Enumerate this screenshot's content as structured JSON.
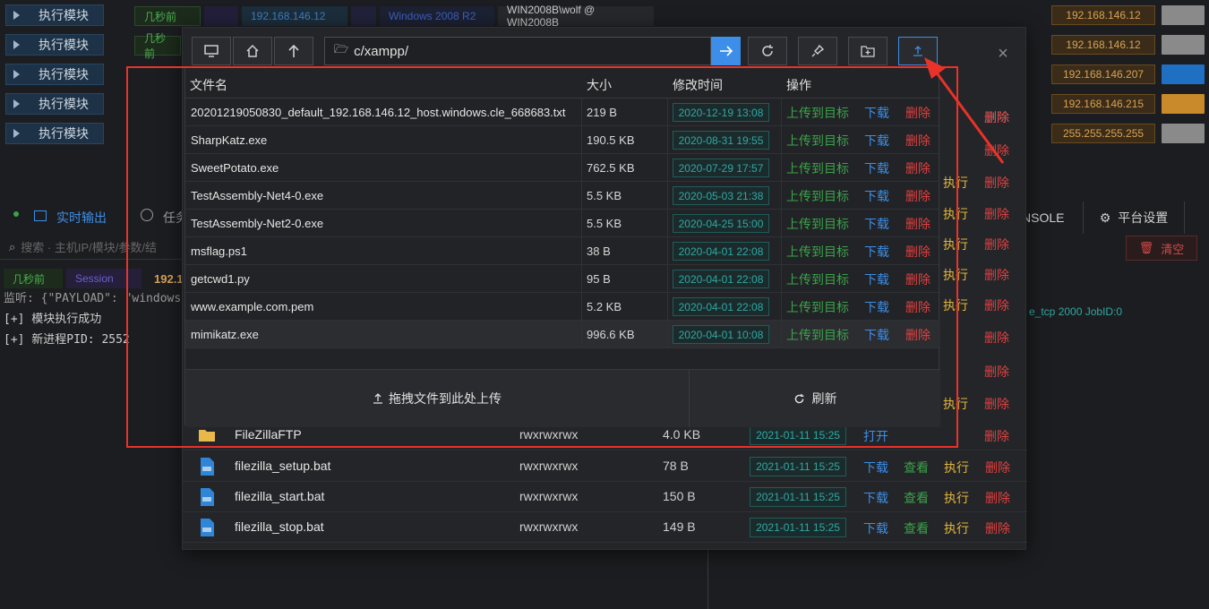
{
  "background": {
    "exec_buttons": [
      "执行模块",
      "执行模块",
      "执行模块",
      "执行模块",
      "执行模块"
    ],
    "session_row": {
      "time": "几秒前",
      "ip": "192.168.146.12",
      "os": "Windows 2008 R2",
      "user": "WIN2008B\\wolf @ WIN2008B"
    },
    "session_row2_time": "几秒前",
    "ip_chips": [
      "192.168.146.12",
      "192.168.146.12",
      "192.168.146.207",
      "192.168.146.215",
      "255.255.255.255"
    ],
    "tabs": {
      "realtime": "实时输出",
      "task": "任务"
    },
    "search_placeholder": "搜索 · 主机IP/模块/参数/结",
    "log_row": {
      "time": "几秒前",
      "session": "Session",
      "ip": "192.1"
    },
    "log_lines": [
      "监听: {\"PAYLOAD\": \"windows/x6",
      "[+] 模块执行成功",
      "[+] 新进程PID: 2552"
    ],
    "right_tabs": {
      "console": "NSOLE",
      "settings": "平台设置"
    },
    "clear_label": "清空",
    "job_text": "e_tcp 2000 JobID:0"
  },
  "modal": {
    "path": "c/xampp/",
    "file_list": [
      {
        "name": "FileZillaFTP",
        "perm": "rwxrwxrwx",
        "size": "4.0 KB",
        "date": "2021-01-11 15:25",
        "ops": [
          "打开"
        ],
        "type": "folder"
      },
      {
        "name": "filezilla_setup.bat",
        "perm": "rwxrwxrwx",
        "size": "78 B",
        "date": "2021-01-11 15:25",
        "ops": [
          "下载",
          "查看",
          "执行",
          "删除"
        ],
        "type": "file"
      },
      {
        "name": "filezilla_start.bat",
        "perm": "rwxrwxrwx",
        "size": "150 B",
        "date": "2021-01-11 15:25",
        "ops": [
          "下载",
          "查看",
          "执行",
          "删除"
        ],
        "type": "file"
      },
      {
        "name": "filezilla_stop.bat",
        "perm": "rwxrwxrwx",
        "size": "149 B",
        "date": "2021-01-11 15:25",
        "ops": [
          "下载",
          "查看",
          "执行",
          "删除"
        ],
        "type": "file"
      }
    ],
    "bg_ops": [
      "删除",
      "删除",
      "删除",
      "执行",
      "删除",
      "执行",
      "删除",
      "执行",
      "删除",
      "执行",
      "删除",
      "执行",
      "删除",
      "执行",
      "删除",
      "删除",
      "删除",
      "执行",
      "删除",
      "删除"
    ]
  },
  "upload_panel": {
    "headers": {
      "name": "文件名",
      "size": "大小",
      "mtime": "修改时间",
      "ops": "操作"
    },
    "rows": [
      {
        "name": "20201219050830_default_192.168.146.12_host.windows.cle_668683.txt",
        "size": "219 B",
        "date": "2020-12-19 13:08"
      },
      {
        "name": "SharpKatz.exe",
        "size": "190.5 KB",
        "date": "2020-08-31 19:55"
      },
      {
        "name": "SweetPotato.exe",
        "size": "762.5 KB",
        "date": "2020-07-29 17:57"
      },
      {
        "name": "TestAssembly-Net4-0.exe",
        "size": "5.5 KB",
        "date": "2020-05-03 21:38"
      },
      {
        "name": "TestAssembly-Net2-0.exe",
        "size": "5.5 KB",
        "date": "2020-04-25 15:00"
      },
      {
        "name": "msflag.ps1",
        "size": "38 B",
        "date": "2020-04-01 22:08"
      },
      {
        "name": "getcwd1.py",
        "size": "95 B",
        "date": "2020-04-01 22:08"
      },
      {
        "name": "www.example.com.pem",
        "size": "5.2 KB",
        "date": "2020-04-01 22:08"
      },
      {
        "name": "mimikatz.exe",
        "size": "996.6 KB",
        "date": "2020-04-01 10:08"
      }
    ],
    "op_upload": "上传到目标",
    "op_download": "下载",
    "op_delete": "删除",
    "drop_label": "拖拽文件到此处上传",
    "refresh_label": "刷新"
  }
}
